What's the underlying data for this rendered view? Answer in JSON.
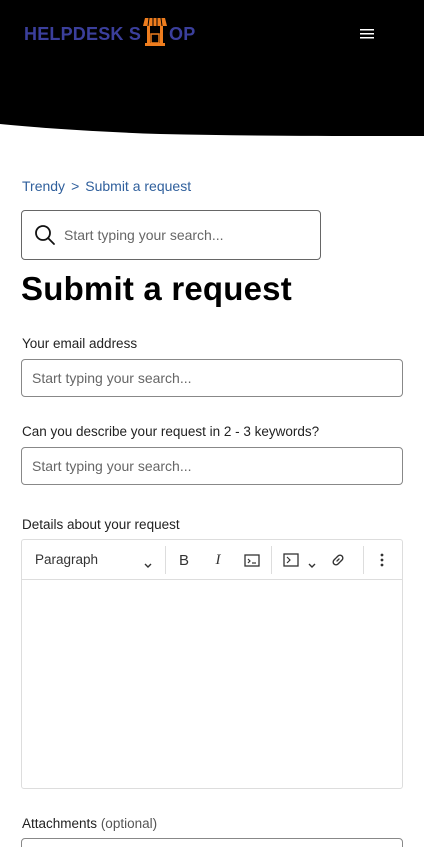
{
  "header": {
    "logo_text_left": "HELPDESK S",
    "logo_text_right": "OP",
    "colors": {
      "background": "#000000",
      "logo_blue": "#3b3f9c",
      "logo_orange": "#ee7d1e"
    }
  },
  "breadcrumb": {
    "items": [
      "Trendy",
      "Submit a request"
    ],
    "separator": ">"
  },
  "search": {
    "placeholder": "Start typing your search..."
  },
  "page_title": "Submit a request",
  "form": {
    "email": {
      "label": "Your email address",
      "placeholder": "Start typing your search..."
    },
    "keywords": {
      "label": "Can you describe your request in 2 - 3 keywords?",
      "placeholder": "Start typing your search..."
    },
    "details": {
      "label": "Details about your request",
      "toolbar": {
        "block_type": "Paragraph",
        "bold": "B",
        "italic": "I"
      }
    },
    "attachments": {
      "label": "Attachments",
      "optional": "(optional)"
    }
  },
  "icons": [
    "store-icon",
    "menu-icon",
    "search-icon",
    "chevron-down-icon",
    "bold-icon",
    "italic-icon",
    "code-icon",
    "code-block-icon",
    "link-icon",
    "more-vertical-icon"
  ]
}
